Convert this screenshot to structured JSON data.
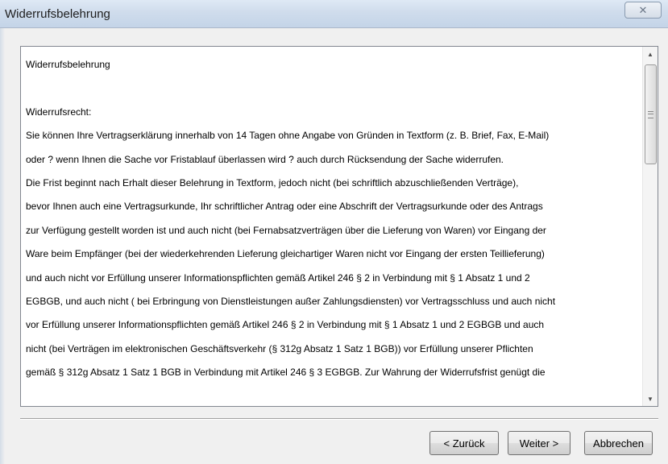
{
  "window": {
    "title": "Widerrufsbelehrung",
    "close_symbol": "✕"
  },
  "document": {
    "lines": [
      "Widerrufsbelehrung",
      "",
      "Widerrufsrecht:",
      "Sie können Ihre Vertragserklärung innerhalb von 14 Tagen ohne Angabe von Gründen in Textform (z. B. Brief, Fax, E-Mail)",
      "oder ? wenn Ihnen die Sache vor Fristablauf überlassen wird ? auch durch Rücksendung der Sache widerrufen.",
      "Die Frist beginnt nach Erhalt dieser Belehrung in Textform, jedoch nicht (bei schriftlich abzuschließenden Verträge),",
      "bevor Ihnen auch eine Vertragsurkunde, Ihr schriftlicher Antrag oder eine Abschrift der Vertragsurkunde oder des Antrags",
      "zur Verfügung gestellt worden ist und auch nicht (bei Fernabsatzverträgen über die Lieferung von Waren) vor Eingang der",
      "Ware beim Empfänger (bei der wiederkehrenden Lieferung gleichartiger Waren nicht vor Eingang der ersten Teillieferung)",
      "und auch nicht vor Erfüllung unserer Informationspflichten gemäß Artikel 246 § 2 in Verbindung mit § 1 Absatz 1 und 2",
      "EGBGB, und auch nicht ( bei Erbringung von Dienstleistungen außer Zahlungsdiensten) vor Vertragsschluss und auch nicht",
      "vor Erfüllung unserer Informationspflichten gemäß Artikel 246 § 2 in Verbindung mit § 1 Absatz 1 und 2 EGBGB und auch",
      "nicht (bei Verträgen im elektronischen Geschäftsverkehr (§ 312g Absatz 1 Satz 1 BGB)) vor Erfüllung unserer Pflichten",
      "gemäß § 312g Absatz 1 Satz 1 BGB in Verbindung mit Artikel 246 § 3 EGBGB. Zur Wahrung der Widerrufsfrist genügt die"
    ]
  },
  "buttons": {
    "back": "< Zurück",
    "next": "Weiter >",
    "cancel": "Abbrechen"
  },
  "scrollbar": {
    "up_symbol": "▲",
    "down_symbol": "▼"
  }
}
